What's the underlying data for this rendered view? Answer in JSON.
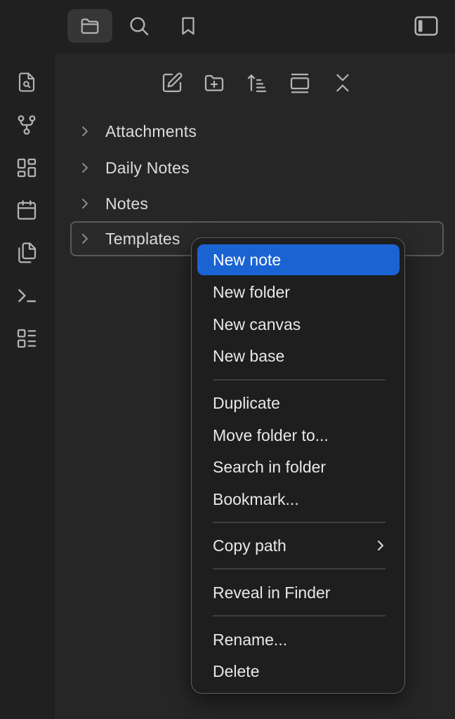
{
  "colors": {
    "background": "#262626",
    "chrome": "#202020",
    "icon": "#b3b3b3",
    "menu_highlight": "#1a63d3",
    "menu_bg": "#1e1e1e"
  },
  "top_tabs": [
    {
      "name": "files",
      "icon": "folder-icon",
      "active": true
    },
    {
      "name": "search",
      "icon": "search-icon",
      "active": false
    },
    {
      "name": "bookmarks",
      "icon": "bookmark-icon",
      "active": false
    }
  ],
  "sidebar_toggle_icon": "sidebar-toggle-icon",
  "ribbon": [
    {
      "name": "quick-switcher",
      "icon": "file-search-icon"
    },
    {
      "name": "graph-view",
      "icon": "git-fork-icon"
    },
    {
      "name": "canvas",
      "icon": "layout-dashboard-icon"
    },
    {
      "name": "daily-note",
      "icon": "calendar-icon"
    },
    {
      "name": "templates",
      "icon": "files-icon"
    },
    {
      "name": "command-palette",
      "icon": "terminal-icon"
    },
    {
      "name": "bases",
      "icon": "list-layout-icon"
    }
  ],
  "nav_actions": [
    {
      "name": "new-note",
      "icon": "edit-icon"
    },
    {
      "name": "new-folder",
      "icon": "folder-plus-icon"
    },
    {
      "name": "sort",
      "icon": "sort-icon"
    },
    {
      "name": "auto-reveal",
      "icon": "reveal-icon"
    },
    {
      "name": "collapse-all",
      "icon": "collapse-icon"
    }
  ],
  "tree": [
    {
      "label": "Attachments",
      "selected": false
    },
    {
      "label": "Daily Notes",
      "selected": false
    },
    {
      "label": "Notes",
      "selected": false
    },
    {
      "label": "Templates",
      "selected": true
    }
  ],
  "context_menu": {
    "groups": [
      [
        {
          "label": "New note",
          "highlighted": true
        },
        {
          "label": "New folder"
        },
        {
          "label": "New canvas"
        },
        {
          "label": "New base"
        }
      ],
      [
        {
          "label": "Duplicate"
        },
        {
          "label": "Move folder to..."
        },
        {
          "label": "Search in folder"
        },
        {
          "label": "Bookmark..."
        }
      ],
      [
        {
          "label": "Copy path",
          "submenu": true
        }
      ],
      [
        {
          "label": "Reveal in Finder"
        }
      ],
      [
        {
          "label": "Rename..."
        },
        {
          "label": "Delete"
        }
      ]
    ]
  }
}
